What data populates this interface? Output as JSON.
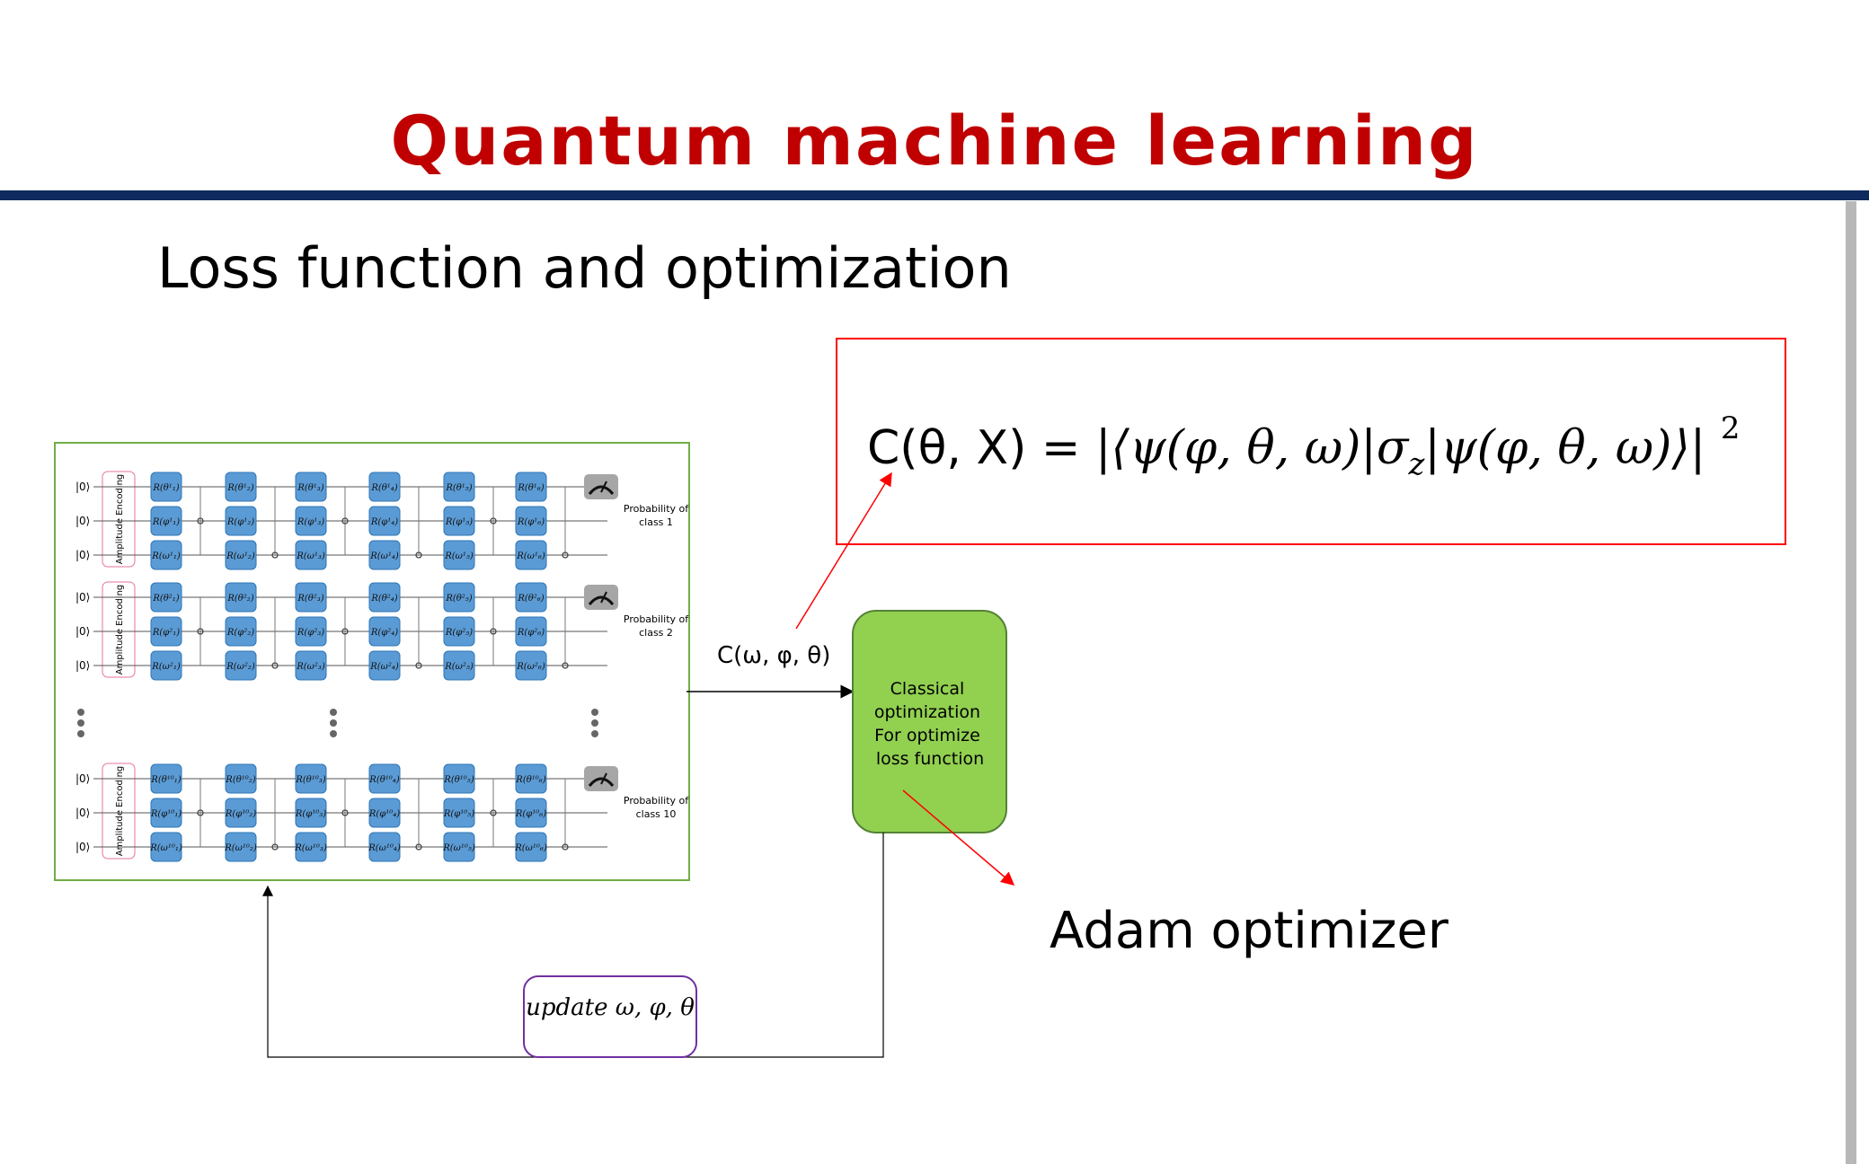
{
  "title": "Quantum machine learning",
  "subtitle": "Loss function and optimization",
  "formula": {
    "lhs": "C(θ, X) = ",
    "rhs": "|⟨ψ(φ, θ, ω)|σ",
    "sub": "z",
    "rhs2": "|ψ(φ, θ, ω)⟩| ",
    "sup": "2"
  },
  "circuit": {
    "qubit_label": "|0⟩",
    "encoding_label": "Amplitude Encoding",
    "blocks": [
      {
        "prob_line1": "Probability of",
        "prob_line2": "class 1",
        "rows": [
          [
            "R(θ¹₁)",
            "R(θ¹₂)",
            "R(θ¹₃)",
            "R(θ¹₄)",
            "R(θ¹₅)",
            "R(θ¹₆)"
          ],
          [
            "R(φ¹₁)",
            "R(φ¹₂)",
            "R(φ¹₃)",
            "R(φ¹₄)",
            "R(φ¹₅)",
            "R(φ¹₆)"
          ],
          [
            "R(ω¹₁)",
            "R(ω¹₂)",
            "R(ω¹₃)",
            "R(ω¹₄)",
            "R(ω¹₅)",
            "R(ω¹₆)"
          ]
        ]
      },
      {
        "prob_line1": "Probability of",
        "prob_line2": "class 2",
        "rows": [
          [
            "R(θ²₁)",
            "R(θ²₂)",
            "R(θ²₃)",
            "R(θ²₄)",
            "R(θ²₅)",
            "R(θ²₆)"
          ],
          [
            "R(φ²₁)",
            "R(φ²₂)",
            "R(φ²₃)",
            "R(φ²₄)",
            "R(φ²₅)",
            "R(φ²₆)"
          ],
          [
            "R(ω²₁)",
            "R(ω²₂)",
            "R(ω²₃)",
            "R(ω²₄)",
            "R(ω²₅)",
            "R(ω²₆)"
          ]
        ]
      },
      {
        "prob_line1": "Probability of",
        "prob_line2": "class 10",
        "rows": [
          [
            "R(θ¹⁰₁)",
            "R(θ¹⁰₂)",
            "R(θ¹⁰₃)",
            "R(θ¹⁰₄)",
            "R(θ¹⁰₅)",
            "R(θ¹⁰₆)"
          ],
          [
            "R(φ¹⁰₁)",
            "R(φ¹⁰₂)",
            "R(φ¹⁰₃)",
            "R(φ¹⁰₄)",
            "R(φ¹⁰₅)",
            "R(φ¹⁰₆)"
          ],
          [
            "R(ω¹⁰₁)",
            "R(ω¹⁰₂)",
            "R(ω¹⁰₃)",
            "R(ω¹⁰₄)",
            "R(ω¹⁰₅)",
            "R(ω¹⁰₆)"
          ]
        ]
      }
    ]
  },
  "cost_label": "C(ω, φ, θ)",
  "optimizer_box": [
    "Classical",
    "optimization",
    "For optimize",
    "loss function"
  ],
  "optimizer_name": "Adam optimizer",
  "update_label": "update ω, φ, θ",
  "colors": {
    "title": "#c00000",
    "bar": "#0f2a5e",
    "gate": "#5b9bd5",
    "optimizer_fill": "#92d050",
    "formula_border": "#ff0000",
    "update_border": "#7030a0",
    "circuit_border": "#70ad47"
  }
}
